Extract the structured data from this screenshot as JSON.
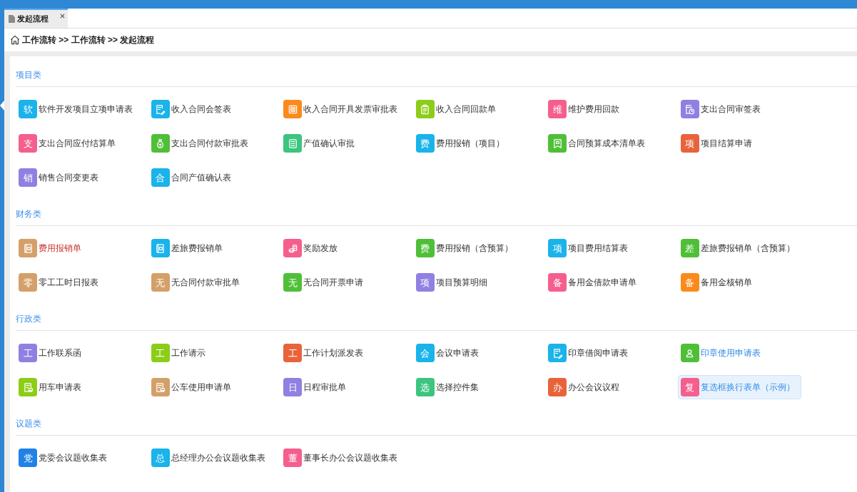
{
  "tabs": [
    {
      "label": "发起流程",
      "selected": true
    }
  ],
  "breadcrumb": "工作流转 >> 工作流转 >> 发起流程",
  "sections": [
    {
      "title": "项目类",
      "items": [
        {
          "label": "软件开发项目立项申请表",
          "kind": "letter",
          "glyph": "软",
          "color": "#1ab3ea",
          "selected": false,
          "flagged": false,
          "visited": false
        },
        {
          "label": "收入合同会签表",
          "kind": "signing",
          "color": "#1ab3ea",
          "selected": false,
          "flagged": false,
          "visited": false
        },
        {
          "label": "收入合同开具发票审批表",
          "kind": "invoice",
          "color": "#fb8a1c",
          "selected": false,
          "flagged": false,
          "visited": false
        },
        {
          "label": "收入合同回款单",
          "kind": "clipboard",
          "color": "#8ccd17",
          "selected": false,
          "flagged": false,
          "visited": false
        },
        {
          "label": "维护费用回款",
          "kind": "letter",
          "glyph": "维",
          "color": "#f55f8d",
          "selected": false,
          "flagged": false,
          "visited": false
        },
        {
          "label": "支出合同审签表",
          "kind": "schedule",
          "color": "#8f80e2",
          "selected": false,
          "flagged": false,
          "visited": false
        },
        {
          "label": "支出合同应付结算单",
          "kind": "letter",
          "glyph": "支",
          "color": "#f55f8d",
          "selected": false,
          "flagged": false,
          "visited": false
        },
        {
          "label": "支出合同付款审批表",
          "kind": "moneybag",
          "color": "#50bf38",
          "selected": false,
          "flagged": false,
          "visited": false
        },
        {
          "label": "产值确认审批",
          "kind": "listing",
          "color": "#3bc57e",
          "selected": false,
          "flagged": false,
          "visited": false
        },
        {
          "label": "费用报销（项目）",
          "kind": "letter",
          "glyph": "费",
          "color": "#1ab3ea",
          "selected": false,
          "flagged": false,
          "visited": false
        },
        {
          "label": "合同预算成本清单表",
          "kind": "bookmark",
          "color": "#50bf38",
          "selected": false,
          "flagged": false,
          "visited": false
        },
        {
          "label": "项目结算申请",
          "kind": "letter",
          "glyph": "项",
          "color": "#e8633b",
          "selected": false,
          "flagged": false,
          "visited": false
        },
        {
          "label": "销售合同变更表",
          "kind": "letter",
          "glyph": "销",
          "color": "#8f80e2",
          "selected": false,
          "flagged": false,
          "visited": false
        },
        {
          "label": "合同产值确认表",
          "kind": "letter",
          "glyph": "合",
          "color": "#1ab3ea",
          "selected": false,
          "flagged": false,
          "visited": false
        }
      ]
    },
    {
      "title": "财务类",
      "items": [
        {
          "label": "费用报销单",
          "kind": "wallet",
          "color": "#d4a06a",
          "selected": false,
          "flagged": true,
          "visited": false
        },
        {
          "label": "差旅费报销单",
          "kind": "wallet",
          "color": "#1ab3ea",
          "selected": false,
          "flagged": false,
          "visited": false
        },
        {
          "label": "奖励发放",
          "kind": "coins",
          "color": "#f55f8d",
          "selected": false,
          "flagged": false,
          "visited": false
        },
        {
          "label": "费用报销（含预算）",
          "kind": "letter",
          "glyph": "费",
          "color": "#50bf38",
          "selected": false,
          "flagged": false,
          "visited": false
        },
        {
          "label": "项目费用结算表",
          "kind": "letter",
          "glyph": "项",
          "color": "#1ab3ea",
          "selected": false,
          "flagged": false,
          "visited": false
        },
        {
          "label": "差旅费报销单（含预算）",
          "kind": "letter",
          "glyph": "差",
          "color": "#50bf38",
          "selected": false,
          "flagged": false,
          "visited": false
        },
        {
          "label": "零工工时日报表",
          "kind": "letter",
          "glyph": "零",
          "color": "#d4a06a",
          "selected": false,
          "flagged": false,
          "visited": false
        },
        {
          "label": "无合同付款审批单",
          "kind": "letter",
          "glyph": "无",
          "color": "#d4a06a",
          "selected": false,
          "flagged": false,
          "visited": false
        },
        {
          "label": "无合同开票申请",
          "kind": "letter",
          "glyph": "无",
          "color": "#50bf38",
          "selected": false,
          "flagged": false,
          "visited": false
        },
        {
          "label": "项目预算明细",
          "kind": "letter",
          "glyph": "项",
          "color": "#8f80e2",
          "selected": false,
          "flagged": false,
          "visited": false
        },
        {
          "label": "备用金借款申请单",
          "kind": "letter",
          "glyph": "备",
          "color": "#f55f8d",
          "selected": false,
          "flagged": false,
          "visited": false
        },
        {
          "label": "备用金核销单",
          "kind": "letter",
          "glyph": "备",
          "color": "#fb8a1c",
          "selected": false,
          "flagged": false,
          "visited": false
        }
      ]
    },
    {
      "title": "行政类",
      "items": [
        {
          "label": "工作联系函",
          "kind": "letter",
          "glyph": "工",
          "color": "#8f80e2",
          "selected": false,
          "flagged": false,
          "visited": false
        },
        {
          "label": "工作请示",
          "kind": "letter",
          "glyph": "工",
          "color": "#8ccd17",
          "selected": false,
          "flagged": false,
          "visited": false
        },
        {
          "label": "工作计划派发表",
          "kind": "letter",
          "glyph": "工",
          "color": "#e8633b",
          "selected": false,
          "flagged": false,
          "visited": false
        },
        {
          "label": "会议申请表",
          "kind": "letter",
          "glyph": "会",
          "color": "#1ab3ea",
          "selected": false,
          "flagged": false,
          "visited": false
        },
        {
          "label": "印章借阅申请表",
          "kind": "signing",
          "color": "#1ab3ea",
          "selected": false,
          "flagged": false,
          "visited": false
        },
        {
          "label": "印章使用申请表",
          "kind": "person",
          "color": "#50bf38",
          "selected": false,
          "flagged": false,
          "visited": true
        },
        {
          "label": "用车申请表",
          "kind": "vehicle",
          "color": "#8ccd17",
          "selected": false,
          "flagged": false,
          "visited": false
        },
        {
          "label": "公车使用申请单",
          "kind": "vehicle",
          "color": "#d4a06a",
          "selected": false,
          "flagged": false,
          "visited": false
        },
        {
          "label": "日程审批单",
          "kind": "letter",
          "glyph": "日",
          "color": "#8f80e2",
          "selected": false,
          "flagged": false,
          "visited": false
        },
        {
          "label": "选择控件集",
          "kind": "letter",
          "glyph": "选",
          "color": "#3bc57e",
          "selected": false,
          "flagged": false,
          "visited": false
        },
        {
          "label": "办公会议议程",
          "kind": "letter",
          "glyph": "办",
          "color": "#e8633b",
          "selected": false,
          "flagged": false,
          "visited": false
        },
        {
          "label": "复选框换行表单（示例）",
          "kind": "letter",
          "glyph": "复",
          "color": "#f55f8d",
          "selected": true,
          "flagged": false,
          "visited": false
        }
      ]
    },
    {
      "title": "议题类",
      "items": [
        {
          "label": "党委会议题收集表",
          "kind": "letter",
          "glyph": "党",
          "color": "#1f82e6",
          "selected": false,
          "flagged": false,
          "visited": false
        },
        {
          "label": "总经理办公会议题收集表",
          "kind": "letter",
          "glyph": "总",
          "color": "#1ab3ea",
          "selected": false,
          "flagged": false,
          "visited": false
        },
        {
          "label": "董事长办公会议题收集表",
          "kind": "letter",
          "glyph": "董",
          "color": "#f55f8d",
          "selected": false,
          "flagged": false,
          "visited": false
        }
      ]
    }
  ]
}
